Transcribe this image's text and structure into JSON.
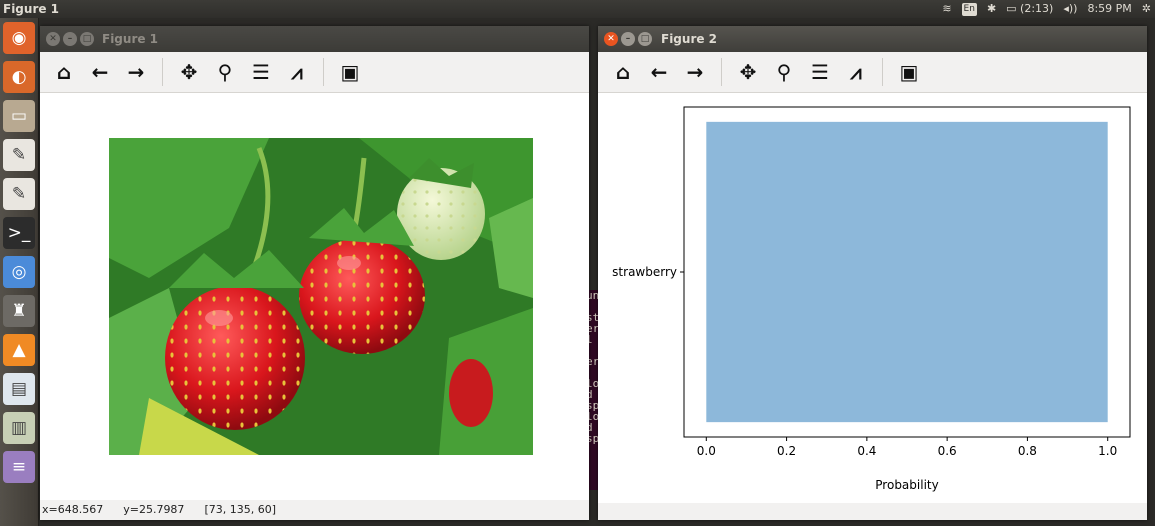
{
  "topbar": {
    "title": "Figure 1",
    "lang": "En",
    "battery": "(2:13)",
    "time": "8:59 PM"
  },
  "launcher": {
    "items": [
      {
        "name": "dash-home-icon",
        "color": "#e0632b",
        "glyph": "◉"
      },
      {
        "name": "firefox-icon",
        "color": "#d9682a",
        "glyph": "◐"
      },
      {
        "name": "files-icon",
        "color": "#b8a991",
        "glyph": "▭"
      },
      {
        "name": "text-editor-icon",
        "color": "#e9e6e0",
        "glyph": "✎"
      },
      {
        "name": "text-editor-2-icon",
        "color": "#e9e6e0",
        "glyph": "✎"
      },
      {
        "name": "terminal-icon",
        "color": "#2c2c2c",
        "glyph": ">_"
      },
      {
        "name": "chromium-icon",
        "color": "#4b8bd9",
        "glyph": "◎"
      },
      {
        "name": "system-monitor-icon",
        "color": "#6d6a65",
        "glyph": "♜"
      },
      {
        "name": "vlc-icon",
        "color": "#f08a24",
        "glyph": "▲"
      },
      {
        "name": "document-viewer-icon",
        "color": "#dfe7ee",
        "glyph": "▤"
      },
      {
        "name": "image-viewer-icon",
        "color": "#c7cfb5",
        "glyph": "▥"
      },
      {
        "name": "app-stack-icon",
        "color": "#9a7ec0",
        "glyph": "≡"
      }
    ]
  },
  "figure1": {
    "title": "Figure 1",
    "status": {
      "x": "x=648.567",
      "y": "y=25.7987",
      "rgb": "[73, 135, 60]"
    }
  },
  "figure2": {
    "title": "Figure 2"
  },
  "toolbar_icons": [
    "home-icon",
    "back-arrow-icon",
    "forward-arrow-icon",
    "pan-icon",
    "zoom-icon",
    "configure-subplots-icon",
    "edit-axes-icon",
    "save-icon"
  ],
  "terminal": {
    "lines": [
      "un",
      "",
      "st",
      "er",
      "l",
      "",
      "er",
      "",
      "lo",
      "d",
      "sp",
      "lo",
      "d",
      "sp"
    ]
  },
  "chart_data": {
    "type": "bar",
    "orientation": "horizontal",
    "categories": [
      "strawberry"
    ],
    "values": [
      1.0
    ],
    "color": "#8db8da",
    "xlabel": "Probability",
    "ylabel": "",
    "xlim": [
      0,
      1.0
    ],
    "xticks": [
      "0.0",
      "0.2",
      "0.4",
      "0.6",
      "0.8",
      "1.0"
    ],
    "grid": false
  }
}
